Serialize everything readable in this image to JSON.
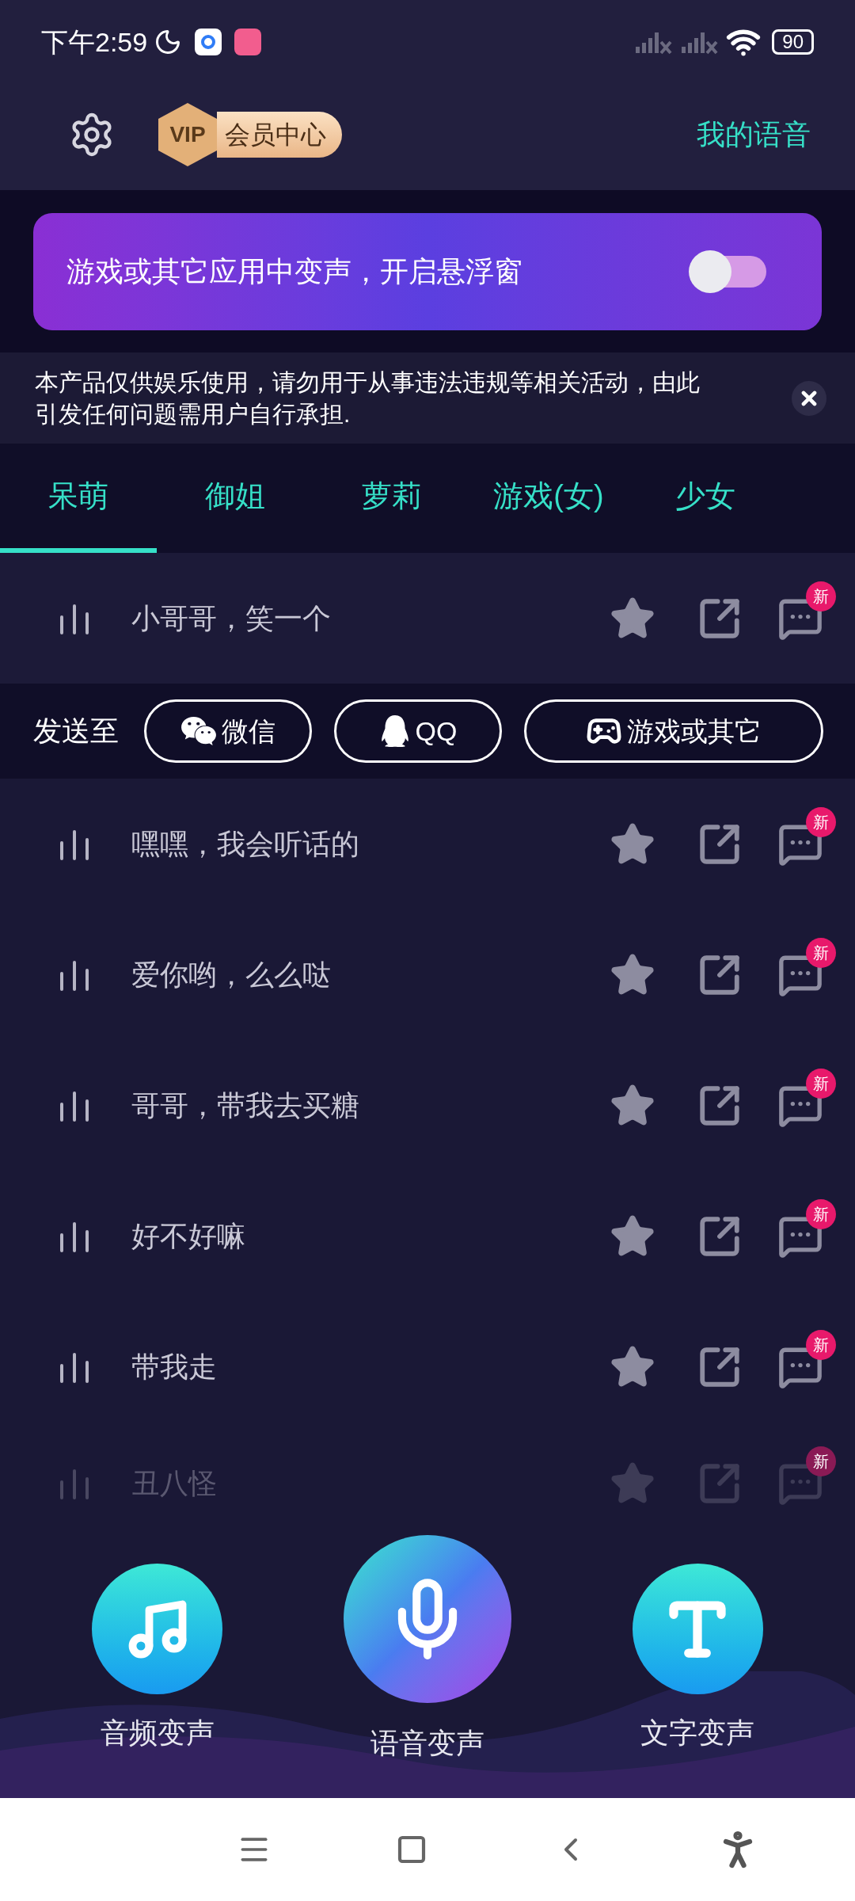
{
  "status_bar": {
    "time": "下午2:59",
    "battery": "90"
  },
  "header": {
    "vip_badge": "VIP",
    "vip_label": "会员中心",
    "my_voice": "我的语音"
  },
  "banner": {
    "text": "游戏或其它应用中变声，开启悬浮窗",
    "on": false
  },
  "notice": {
    "text": "本产品仅供娱乐使用，请勿用于从事违法违规等相关活动，由此引发任何问题需用户自行承担."
  },
  "tabs": [
    {
      "label": "呆萌",
      "selected": true
    },
    {
      "label": "御姐",
      "selected": false
    },
    {
      "label": "萝莉",
      "selected": false
    },
    {
      "label": "游戏(女)",
      "selected": false
    },
    {
      "label": "少女",
      "selected": false
    }
  ],
  "voices": [
    {
      "label": "小哥哥，笑一个",
      "badge": "新",
      "expanded": true,
      "faded": false
    },
    {
      "label": "嘿嘿，我会听话的",
      "badge": "新",
      "expanded": false,
      "faded": false
    },
    {
      "label": "爱你哟，么么哒",
      "badge": "新",
      "expanded": false,
      "faded": false
    },
    {
      "label": "哥哥，带我去买糖",
      "badge": "新",
      "expanded": false,
      "faded": false
    },
    {
      "label": "好不好嘛",
      "badge": "新",
      "expanded": false,
      "faded": false
    },
    {
      "label": "带我走",
      "badge": "新",
      "expanded": false,
      "faded": false
    },
    {
      "label": "丑八怪",
      "badge": "新",
      "expanded": false,
      "faded": true
    }
  ],
  "send_bar": {
    "label": "发送至",
    "targets": [
      {
        "kind": "wechat",
        "label": "微信"
      },
      {
        "kind": "qq",
        "label": "QQ"
      },
      {
        "kind": "game",
        "label": "游戏或其它"
      }
    ]
  },
  "actions": [
    {
      "kind": "music",
      "label": "音频变声",
      "selected": false
    },
    {
      "kind": "mic",
      "label": "语音变声",
      "selected": true
    },
    {
      "kind": "text",
      "label": "文字变声",
      "selected": false
    }
  ]
}
